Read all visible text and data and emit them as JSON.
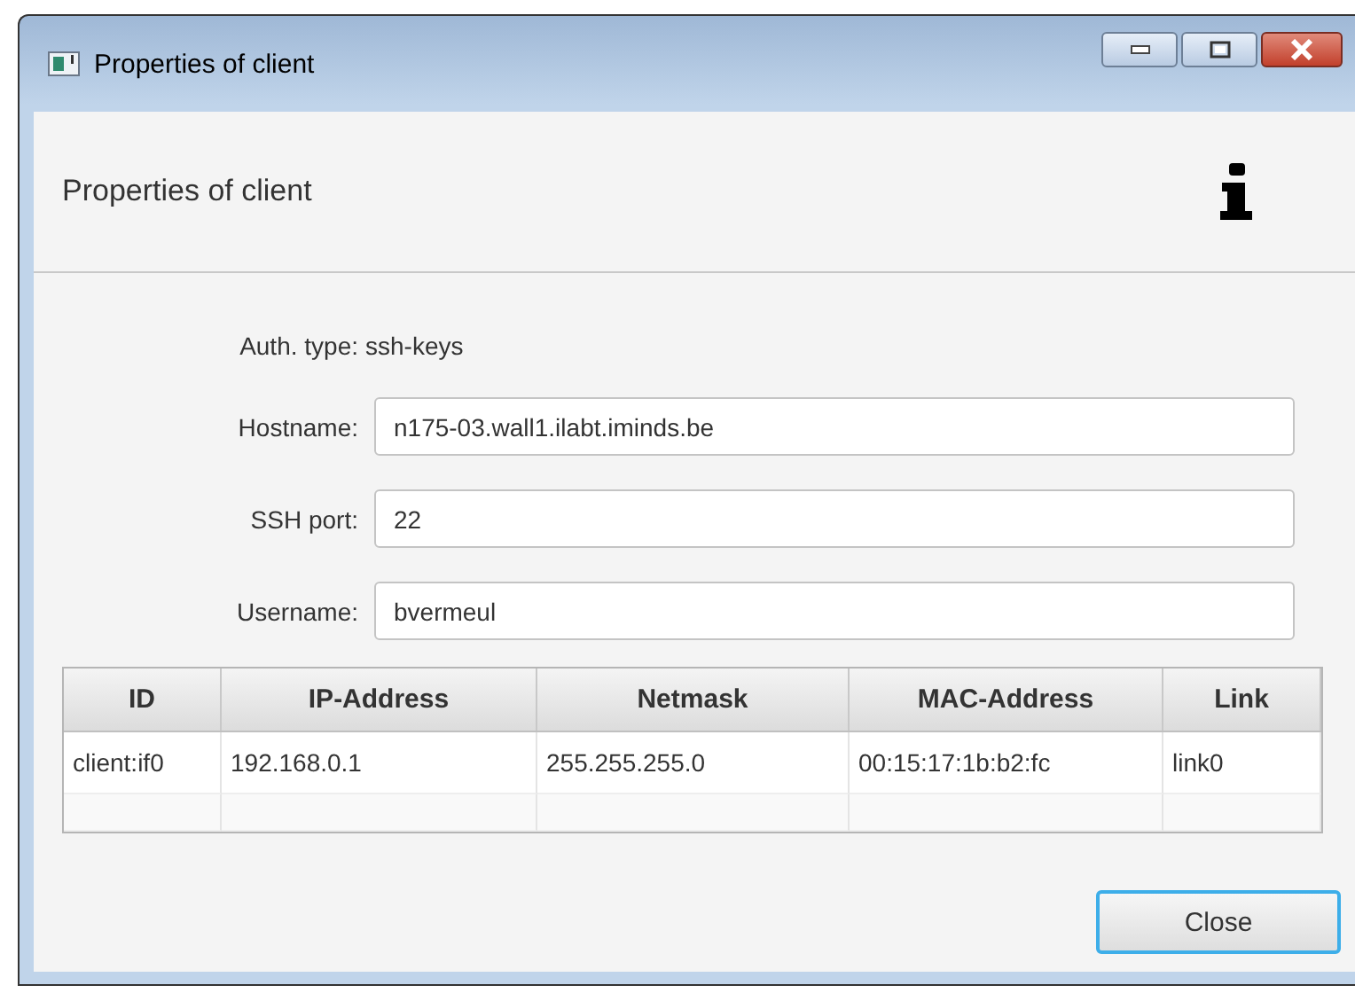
{
  "window": {
    "title": "Properties of client"
  },
  "header": {
    "title": "Properties of client"
  },
  "auth": {
    "label": "Auth. type:",
    "value": "ssh-keys"
  },
  "fields": [
    {
      "label": "Hostname:",
      "value": "n175-03.wall1.ilabt.iminds.be"
    },
    {
      "label": "SSH port:",
      "value": "22"
    },
    {
      "label": "Username:",
      "value": "bvermeul"
    }
  ],
  "table": {
    "columns": [
      "ID",
      "IP-Address",
      "Netmask",
      "MAC-Address",
      "Link"
    ],
    "rows": [
      [
        "client:if0",
        "192.168.0.1",
        "255.255.255.0",
        "00:15:17:1b:b2:fc",
        "link0"
      ]
    ]
  },
  "buttons": [
    {
      "label": "Close",
      "focused": true
    }
  ]
}
